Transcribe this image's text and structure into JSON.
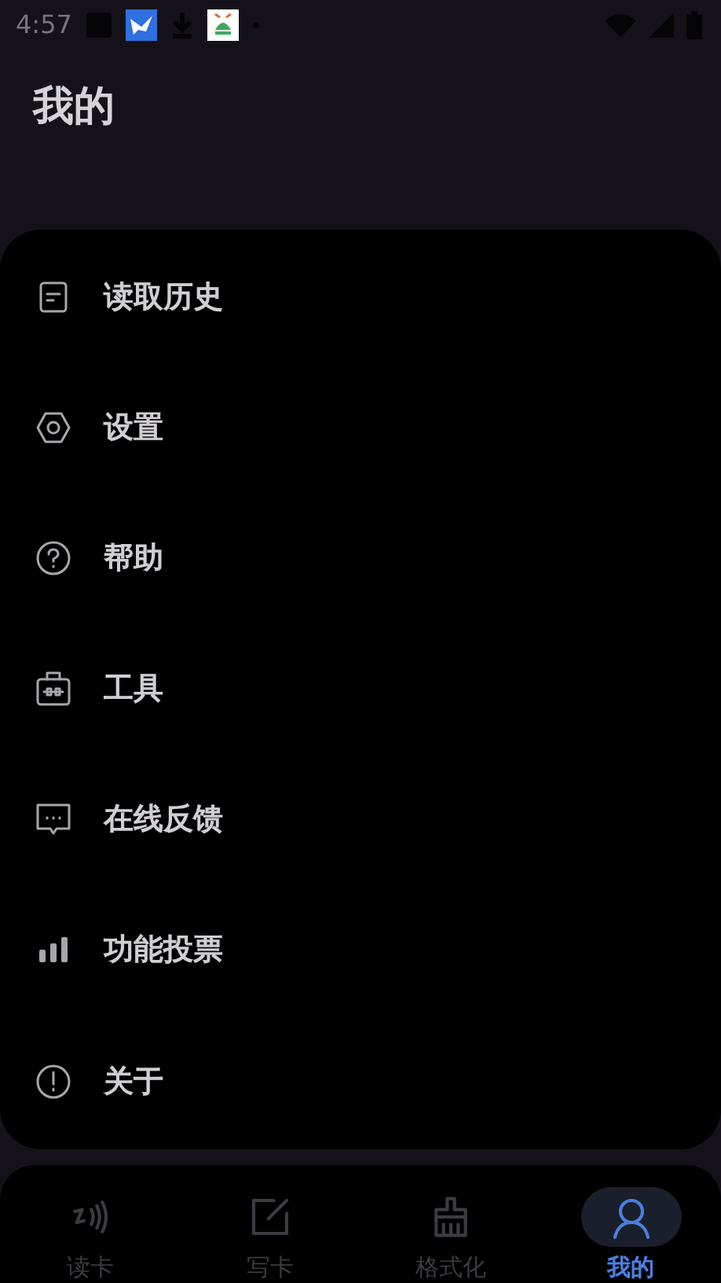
{
  "status_bar": {
    "time": "4:57"
  },
  "header": {
    "title": "我的"
  },
  "menu": [
    {
      "kind": "history",
      "label": "读取历史"
    },
    {
      "kind": "settings",
      "label": "设置"
    },
    {
      "kind": "help",
      "label": "帮助"
    },
    {
      "kind": "tools",
      "label": "工具"
    },
    {
      "kind": "feedback",
      "label": "在线反馈"
    },
    {
      "kind": "vote",
      "label": "功能投票"
    },
    {
      "kind": "about",
      "label": "关于"
    }
  ],
  "bottom_nav": [
    {
      "kind": "read",
      "label": "读卡",
      "selected": false
    },
    {
      "kind": "write",
      "label": "写卡",
      "selected": false
    },
    {
      "kind": "format",
      "label": "格式化",
      "selected": false
    },
    {
      "kind": "mine",
      "label": "我的",
      "selected": true
    }
  ]
}
